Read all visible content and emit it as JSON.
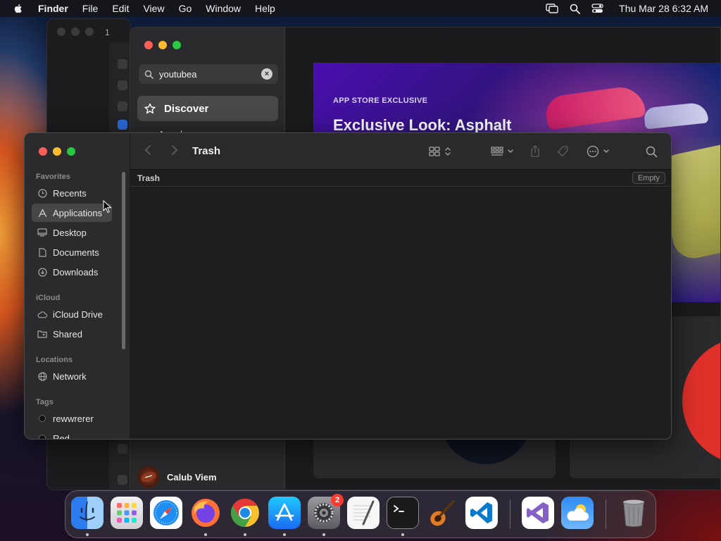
{
  "menubar": {
    "app_name": "Finder",
    "items": [
      "File",
      "Edit",
      "View",
      "Go",
      "Window",
      "Help"
    ],
    "datetime": "Thu Mar 28  6:32 AM"
  },
  "background_window": {
    "title_fragment": "1"
  },
  "appstore": {
    "search_value": "youtubea",
    "sidebar_selected": "Discover",
    "sidebar_next": "Arcade",
    "user_name": "Calub Viem",
    "banner": {
      "kicker": "APP STORE EXCLUSIVE",
      "headline": "Exclusive Look: Asphalt"
    }
  },
  "finder": {
    "title": "Trash",
    "path_label": "Trash",
    "empty_button": "Empty",
    "sections": {
      "favorites": "Favorites",
      "icloud": "iCloud",
      "locations": "Locations",
      "tags": "Tags"
    },
    "favorites": [
      {
        "label": "Recents",
        "icon": "clock-icon"
      },
      {
        "label": "Applications",
        "icon": "applications-icon"
      },
      {
        "label": "Desktop",
        "icon": "desktop-icon"
      },
      {
        "label": "Documents",
        "icon": "document-icon"
      },
      {
        "label": "Downloads",
        "icon": "download-icon"
      }
    ],
    "icloud": [
      {
        "label": "iCloud Drive",
        "icon": "cloud-icon"
      },
      {
        "label": "Shared",
        "icon": "shared-folder-icon"
      }
    ],
    "locations": [
      {
        "label": "Network",
        "icon": "globe-icon"
      }
    ],
    "tags": [
      {
        "label": "rewwrerer"
      },
      {
        "label": "Red"
      }
    ],
    "selected_item": "Applications"
  },
  "dock": {
    "apps": [
      "Finder",
      "Launchpad",
      "Safari",
      "Firefox",
      "Chrome",
      "App Store",
      "System Settings",
      "TextEdit",
      "Terminal",
      "GarageBand",
      "Visual Studio Code",
      "Visual Studio",
      "Weather",
      "Trash"
    ],
    "system_settings_badge": "2"
  },
  "colors": {
    "close": "#ff5f57",
    "minimize": "#febc2e",
    "zoom": "#28c840",
    "badge": "#ff3b30"
  }
}
